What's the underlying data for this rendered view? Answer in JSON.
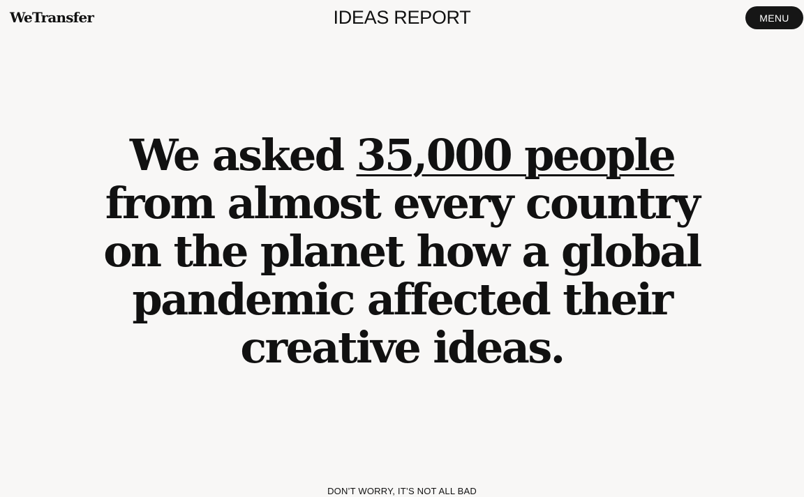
{
  "header": {
    "logo": "WeTransfer",
    "title": "IDEAS REPORT",
    "menu_label": "MENU"
  },
  "hero": {
    "line1_prefix": "We asked ",
    "line1_link": "35,000 people",
    "line2": "from almost every country",
    "line3": "on the planet how a global",
    "line4": "pandemic affected their",
    "line5": "creative ideas."
  },
  "footer": {
    "scroll_hint": "DON’T WORRY, IT’S NOT ALL BAD"
  },
  "colors": {
    "background": "#f8f7f6",
    "text": "#111111",
    "menu_button": "#161616",
    "menu_text": "#ffffff"
  }
}
